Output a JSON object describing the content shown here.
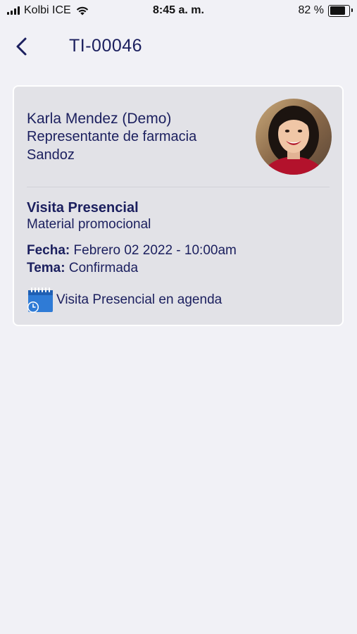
{
  "status_bar": {
    "carrier": "Kolbi ICE",
    "time": "8:45 a. m.",
    "battery": "82 %",
    "battery_level": 0.82,
    "icons": [
      "signal-icon",
      "wifi-icon",
      "battery-icon"
    ]
  },
  "header": {
    "title": "TI-00046",
    "back_icon": "chevron-left-icon"
  },
  "card": {
    "name": "Karla Mendez (Demo)",
    "role": "Representante de farmacia",
    "company": "Sandoz",
    "visit_type": "Visita Presencial",
    "visit_subtitle": "Material promocional",
    "date_label": "Fecha:",
    "date_value": "Febrero 02 2022 - 10:00am",
    "topic_label": "Tema:",
    "topic_value": "Confirmada",
    "agenda_text": "Visita Presencial en agenda",
    "agenda_icon": "calendar-clock-icon"
  },
  "colors": {
    "primary_text": "#1b1f5e",
    "background": "#f1f1f6",
    "card": "#e2e2e7",
    "accent_blue": "#2f7bd6"
  }
}
